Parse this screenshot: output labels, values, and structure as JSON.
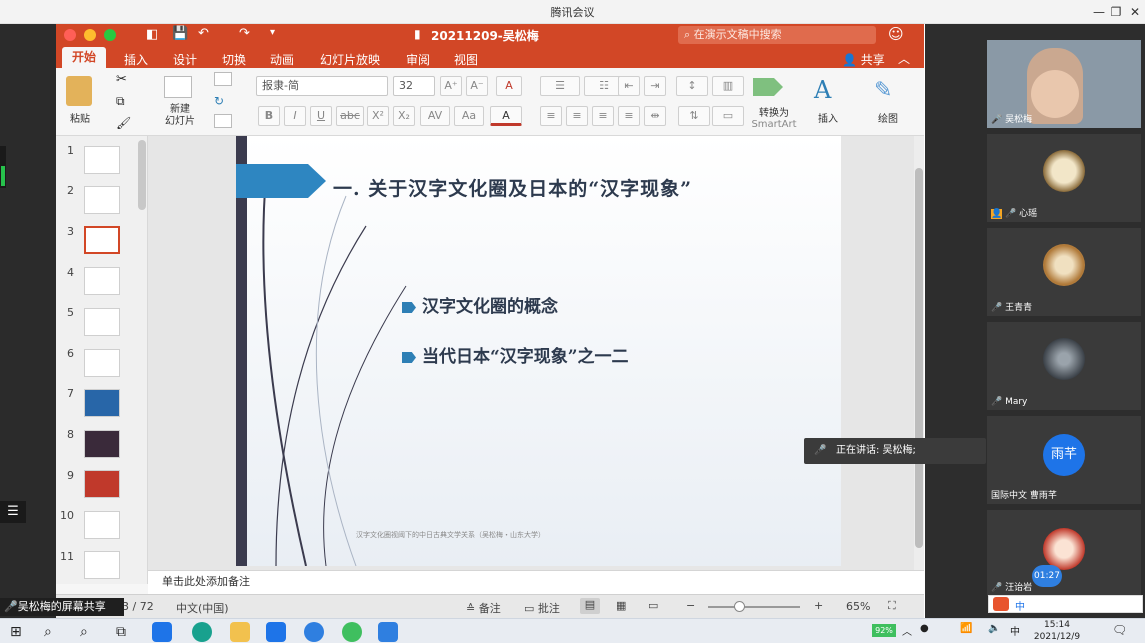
{
  "meeting": {
    "title": "腾讯会议",
    "min": "—",
    "max": "❐",
    "close": "✕",
    "share_label": "吴松梅的屏幕共享",
    "speaking": "正在讲话: 吴松梅;"
  },
  "ppt": {
    "filename": "20211209-吴松梅",
    "search_placeholder": "在演示文稿中搜索",
    "share": "共享",
    "tabs": [
      "开始",
      "插入",
      "设计",
      "切换",
      "动画",
      "幻灯片放映",
      "审阅",
      "视图"
    ],
    "ribbon": {
      "paste": "粘贴",
      "new_slide": "新建\n幻灯片",
      "new_slide_1": "新建",
      "new_slide_2": "幻灯片",
      "font_name": "报隶-简",
      "font_size": "32",
      "smartart_1": "转换为",
      "smartart_2": "SmartArt",
      "insert": "插入",
      "draw": "绘图",
      "bold": "B",
      "italic": "I",
      "underline": "U",
      "strike": "abc",
      "sup": "X²",
      "sub": "X₂",
      "font_a": "A"
    },
    "thumbs": [
      "1",
      "2",
      "3",
      "4",
      "5",
      "6",
      "7",
      "8",
      "9",
      "10",
      "11"
    ],
    "selected_thumb": 3,
    "slide": {
      "title": "一. 关于汉字文化圈及日本的“汉字现象”",
      "bullets": [
        "汉字文化圈的概念",
        "当代日本“汉字现象”之一二"
      ],
      "footer": "汉字文化圈视阈下的中日古典文学关系（吴松梅・山东大学）"
    },
    "notes_placeholder": "单击此处添加备注",
    "status": {
      "slide_of": "3 / 72",
      "language": "中文(中国)",
      "notes": "备注",
      "comments": "批注",
      "zoom": "65%"
    }
  },
  "participants": [
    {
      "name": "吴松梅"
    },
    {
      "name": "心瑶"
    },
    {
      "name": "王青青"
    },
    {
      "name": "Mary"
    },
    {
      "name": "国际中文 曹雨芊",
      "avatar_text": "雨芊"
    },
    {
      "name": "汪诒岩"
    }
  ],
  "timer": "01:27",
  "taskbar": {
    "battery": "92%",
    "ime": "中",
    "time": "15:14",
    "date": "2021/12/9"
  },
  "colors": {
    "ppt_accent": "#d24726",
    "avatar_blue": "#1e74e8"
  }
}
